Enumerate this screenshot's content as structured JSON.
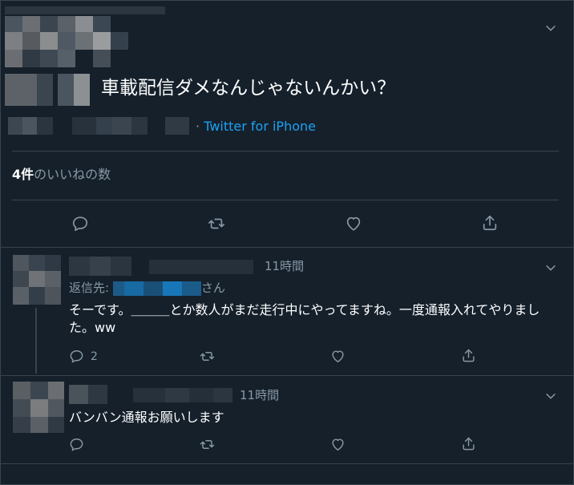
{
  "main_tweet": {
    "text": "車載配信ダメなんじゃないんかい？",
    "separator": "·",
    "source": "Twitter for iPhone",
    "likes_count": "4件",
    "likes_label": "のいいねの数"
  },
  "replies": [
    {
      "time": "11時間",
      "reply_to_prefix": "返信先:",
      "reply_to_suffix": "さん",
      "text": "そーです。＿＿＿とか数人がまだ走行中にやってますね。一度通報入れてやりました。ww",
      "reply_count": "2"
    },
    {
      "time": "11時間",
      "text": "バンバン通報お願いします"
    }
  ],
  "colors": {
    "background": "#15202b",
    "border": "#38444d",
    "secondary_text": "#8899a6",
    "link": "#1da1f2"
  },
  "icons": [
    "chevron-down-icon",
    "reply-icon",
    "retweet-icon",
    "like-icon",
    "share-icon"
  ]
}
